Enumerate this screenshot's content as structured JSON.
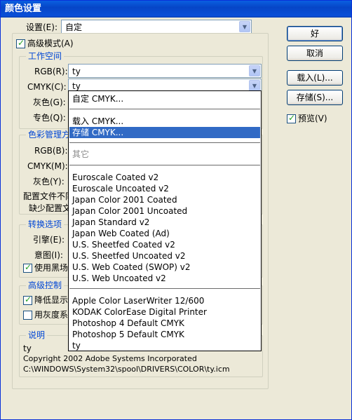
{
  "window": {
    "title": "颜色设置"
  },
  "settings": {
    "label": "设置(E):",
    "value": "自定"
  },
  "advanced_mode": {
    "label": "高级模式(A)",
    "checked": true
  },
  "working_spaces": {
    "title": "工作空间",
    "rgb_label": "RGB(R):",
    "rgb_value": "ty",
    "cmyk_label": "CMYK(C):",
    "cmyk_value": "ty",
    "gray_label": "灰色(G):",
    "spot_label": "专色(Q):"
  },
  "color_management": {
    "title": "色彩管理方",
    "rgb_label": "RGB(B):",
    "cmyk_label": "CMYK(M):",
    "gray_label": "灰色(Y):",
    "profile_mismatch_label": "配置文件不同",
    "missing_profile_label": "缺少配置文"
  },
  "conversion": {
    "title": "转换选项",
    "engine_label": "引擎(E):",
    "intent_label": "意图(I):",
    "black_point_label": "使用黑场",
    "black_point_checked": true
  },
  "advanced_controls": {
    "title": "高级控制",
    "desaturate_label": "降低显示",
    "desaturate_checked": true,
    "gray_gamma_label": "用灰度系",
    "gray_gamma_checked": false
  },
  "description": {
    "title": "说明",
    "line1": "ty",
    "line2": "Copyright 2002 Adobe Systems Incorporated",
    "line3": "C:\\WINDOWS\\System32\\spool\\DRIVERS\\COLOR\\ty.icm"
  },
  "buttons": {
    "ok": "好",
    "cancel": "取消",
    "load": "载入(L)...",
    "save": "存储(S)...",
    "preview_label": "预览(V)",
    "preview_checked": true
  },
  "cmyk_dropdown": {
    "items": [
      "自定 CMYK...",
      "载入 CMYK...",
      "存储 CMYK...",
      "其它",
      "Euroscale Coated v2",
      "Euroscale Uncoated v2",
      "Japan Color 2001 Coated",
      "Japan Color 2001 Uncoated",
      "Japan Standard v2",
      "Japan Web Coated (Ad)",
      "U.S. Sheetfed Coated v2",
      "U.S. Sheetfed Uncoated v2",
      "U.S. Web Coated (SWOP) v2",
      "U.S. Web Uncoated v2",
      "Apple Color LaserWriter 12/600",
      "KODAK ColorEase Digital Printer",
      "Photoshop 4 Default CMYK",
      "Photoshop 5 Default CMYK",
      "ty"
    ],
    "selected": "存储 CMYK..."
  },
  "colors": {
    "accent": "#316ac5",
    "group_title": "#0046d5",
    "titlebar": "#0a4fd8"
  }
}
